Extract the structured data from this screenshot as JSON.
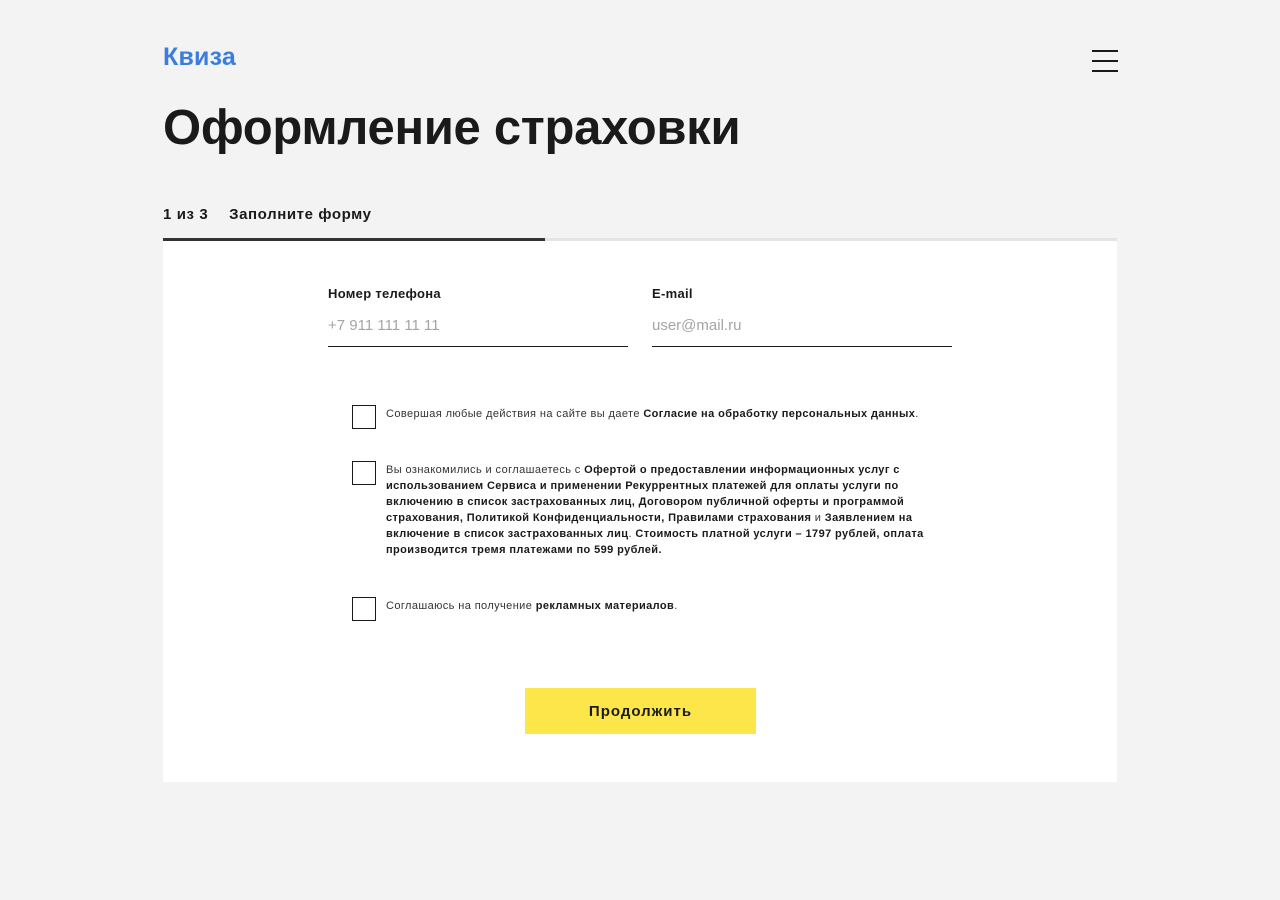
{
  "header": {
    "logo": "Квиза",
    "menu_icon": "hamburger-menu-icon"
  },
  "page": {
    "title": "Оформление страховки"
  },
  "step": {
    "count": "1 из 3",
    "label": "Заполните форму",
    "progress_fraction": 0.4
  },
  "form": {
    "phone": {
      "label": "Номер телефона",
      "placeholder": "+7 911 111 11 11",
      "value": ""
    },
    "email": {
      "label": "E-mail",
      "placeholder": "user@mail.ru",
      "value": ""
    },
    "consents": [
      {
        "checked": false,
        "parts": [
          {
            "t": "Совершая любые действия на сайте вы даете ",
            "bold": false
          },
          {
            "t": "Согласие на обработку персональных данных",
            "bold": true
          },
          {
            "t": ".",
            "bold": false
          }
        ]
      },
      {
        "checked": false,
        "parts": [
          {
            "t": "Вы ознакомились и соглашаетесь с ",
            "bold": false
          },
          {
            "t": "Офертой о предоставлении информационных услуг с использованием Сервиса и применении Рекуррентных платежей для оплаты услуги по включению в список застрахованных лиц, Договором публичной оферты и программой страхования, Политикой Конфиденциальности, Правилами страхования",
            "bold": true
          },
          {
            "t": " и ",
            "bold": false
          },
          {
            "t": "Заявлением на включение в список застрахованных лиц",
            "bold": true
          },
          {
            "t": ". ",
            "bold": false
          },
          {
            "t": "Стоимость платной услуги – 1797 рублей, оплата производится тремя платежами по 599 рублей.",
            "bold": true
          }
        ]
      },
      {
        "checked": false,
        "parts": [
          {
            "t": "Соглашаюсь на получение ",
            "bold": false
          },
          {
            "t": "рекламных материалов",
            "bold": true
          },
          {
            "t": ".",
            "bold": false
          }
        ]
      }
    ],
    "submit_label": "Продолжить"
  }
}
